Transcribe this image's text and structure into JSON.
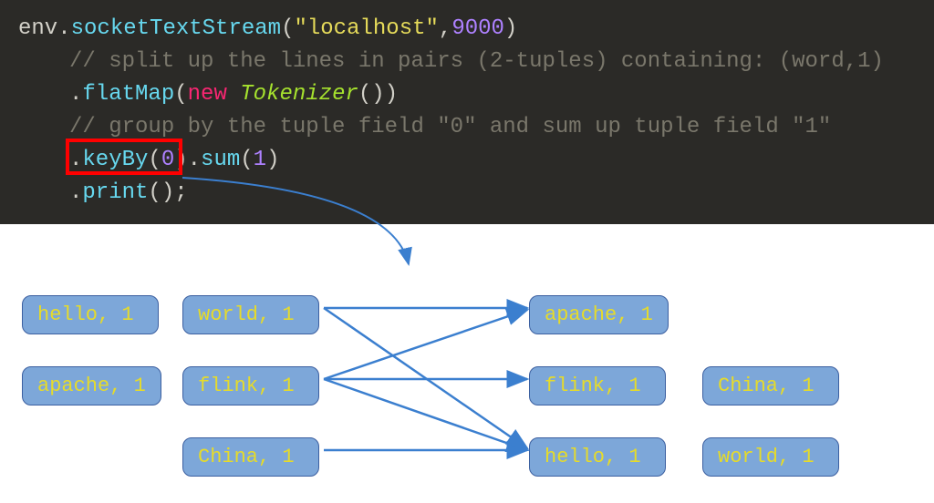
{
  "code": {
    "line1": {
      "env": "env",
      "dot1": ".",
      "method": "socketTextStream",
      "op": "(",
      "str": "\"localhost\"",
      "comma": ",",
      "num": "9000",
      "cp": ")"
    },
    "line2_comment": "// split up the lines in pairs (2-tuples) containing: (word,1)",
    "line3": {
      "dot": ".",
      "method": "flatMap",
      "op": "(",
      "kw": "new",
      "sp": " ",
      "type": "Tokenizer",
      "call": "()",
      "cp": ")"
    },
    "line4_comment": "// group by the tuple field \"0\" and sum up tuple field \"1\"",
    "line5": {
      "dot1": ".",
      "m1": "keyBy",
      "op1": "(",
      "n1": "0",
      "cp1": ")",
      "dot2": ".",
      "m2": "sum",
      "op2": "(",
      "n2": "1",
      "cp2": ")"
    },
    "line6": {
      "dot": ".",
      "method": "print",
      "call": "();"
    }
  },
  "tuples": {
    "left": [
      {
        "text": "hello, 1"
      },
      {
        "text": "world, 1"
      },
      {
        "text": "apache, 1"
      },
      {
        "text": "flink, 1"
      },
      {
        "text": "China, 1"
      }
    ],
    "right": [
      {
        "text": "apache, 1"
      },
      {
        "text": "flink, 1"
      },
      {
        "text": "China, 1"
      },
      {
        "text": "hello, 1"
      },
      {
        "text": "world, 1"
      }
    ]
  },
  "colors": {
    "code_bg": "#2b2a27",
    "tuple_fill": "#7da7d9",
    "tuple_border": "#3b5fa0",
    "tuple_text": "#e6db2a",
    "arrow": "#3b7fcf",
    "highlight": "#ff0000"
  },
  "chart_data": {
    "type": "table",
    "title": "keyBy(0) shuffling of (word,1) tuples",
    "edges": [
      {
        "from": "hello, 1",
        "to": "hello, 1"
      },
      {
        "from": "world, 1",
        "to": "apache, 1"
      },
      {
        "from": "apache, 1",
        "to": "flink, 1"
      },
      {
        "from": "flink, 1",
        "to": "flink, 1"
      },
      {
        "from": "flink, 1",
        "to": "hello, 1"
      },
      {
        "from": "China, 1",
        "to": "hello, 1"
      }
    ],
    "left_nodes": [
      "hello, 1",
      "world, 1",
      "apache, 1",
      "flink, 1",
      "China, 1"
    ],
    "right_nodes": [
      "apache, 1",
      "flink, 1",
      "China, 1",
      "hello, 1",
      "world, 1"
    ]
  }
}
